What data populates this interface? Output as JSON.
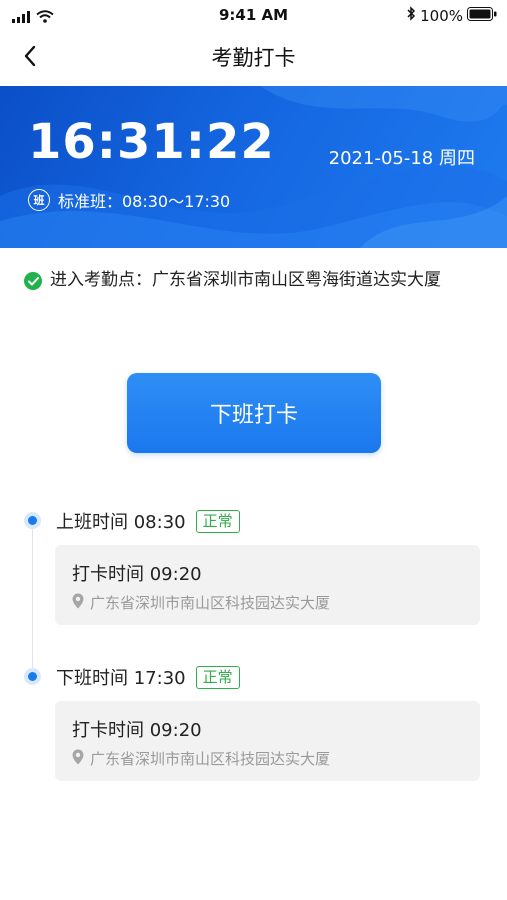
{
  "status_bar": {
    "time": "9:41 AM",
    "battery": "100%",
    "icons": [
      "signal-icon",
      "wifi-icon",
      "bluetooth-icon",
      "battery-icon"
    ]
  },
  "nav": {
    "title": "考勤打卡",
    "back_icon": "chevron-left-icon"
  },
  "hero": {
    "clock": "16:31:22",
    "date": "2021-05-18  周四",
    "shift_badge": "班",
    "shift_text": "标准班：08:30～17:30"
  },
  "location": {
    "icon": "check-circle-icon",
    "text": "进入考勤点：广东省深圳市南山区粤海街道达实大厦"
  },
  "punch_button": {
    "label": "下班打卡"
  },
  "records": [
    {
      "heading": "上班时间 08:30",
      "status": "正常",
      "punch_time": "打卡时间 09:20",
      "address": "广东省深圳市南山区科技园达实大厦"
    },
    {
      "heading": "下班时间 17:30",
      "status": "正常",
      "punch_time": "打卡时间 09:20",
      "address": "广东省深圳市南山区科技园达实大厦"
    }
  ],
  "colors": {
    "primary": "#1a78ee",
    "success": "#2fae4a",
    "hero_dark": "#0b4fc7",
    "card_bg": "#f2f2f2"
  }
}
